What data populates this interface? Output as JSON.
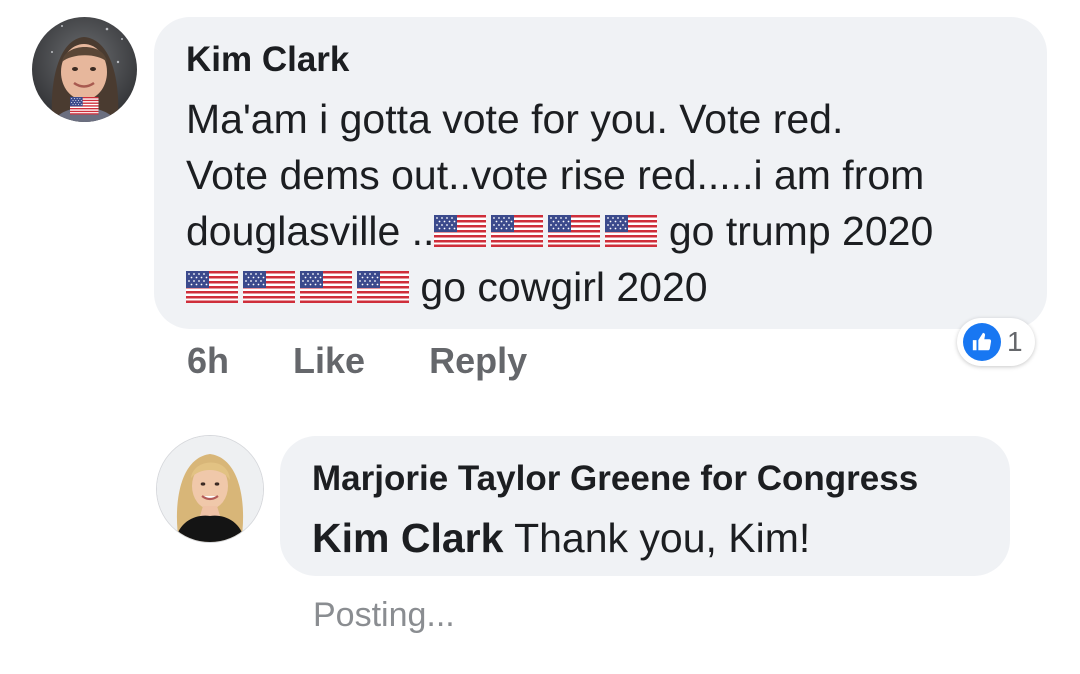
{
  "comment": {
    "author": "Kim Clark",
    "lines": [
      "Ma'am i gotta vote for you. Vote red.",
      "Vote dems out..vote rise red.....i am from"
    ],
    "line3_prefix": "douglasville ..",
    "line3_suffix": "go trump 2020",
    "line4_suffix": "go cowgirl 2020",
    "flag_emoji": "us-flag-emoji",
    "time": "6h",
    "like_label": "Like",
    "reply_label": "Reply",
    "reaction": {
      "icon": "thumbs-up-icon",
      "count": "1",
      "color": "#1877f2"
    }
  },
  "reply": {
    "author": "Marjorie Taylor Greene for Congress",
    "mention": "Kim Clark",
    "text": "Thank you, Kim!",
    "status": "Posting..."
  },
  "colors": {
    "bubble": "#f0f2f5",
    "text": "#1c1e21",
    "secondary": "#65676b",
    "accent": "#1877f2"
  }
}
